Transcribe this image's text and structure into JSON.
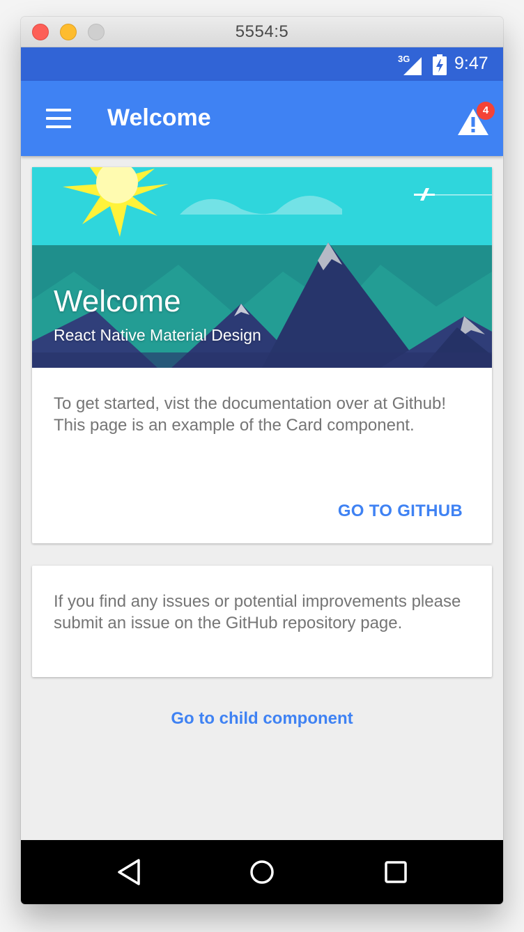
{
  "window": {
    "title": "5554:5"
  },
  "status_bar": {
    "network_label": "3G",
    "time": "9:47"
  },
  "app_bar": {
    "title": "Welcome",
    "notification_count": "4"
  },
  "cards": [
    {
      "media_title": "Welcome",
      "media_subtitle": "React Native Material Design",
      "body": "To get started, vist the documentation over at Github! This page is an example of the Card component.",
      "action_label": "GO TO GITHUB"
    },
    {
      "body": "If you find any issues or potential improvements please submit an issue on the GitHub repository page."
    }
  ],
  "links": {
    "child_component": "Go to child component"
  },
  "colors": {
    "status_bar": "#3164d6",
    "app_bar": "#3f82f3",
    "accent": "#3f82f3",
    "badge": "#f44336",
    "background": "#eeeeee"
  }
}
